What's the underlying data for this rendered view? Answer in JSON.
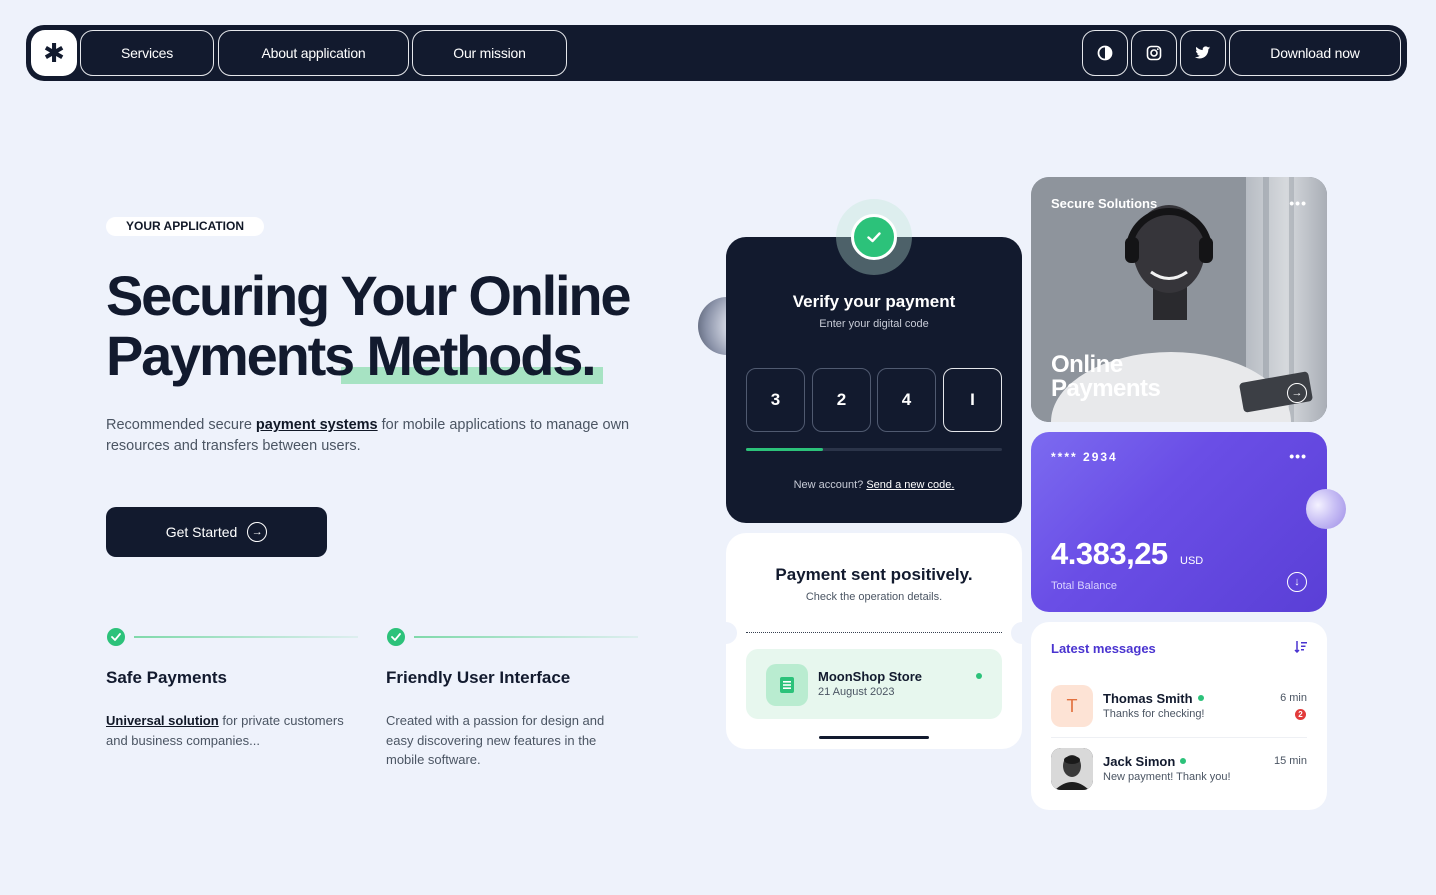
{
  "nav": {
    "logo": "✱",
    "links": [
      "Services",
      "About application",
      "Our mission"
    ],
    "icons": [
      "theme-toggle-icon",
      "instagram-icon",
      "twitter-icon"
    ],
    "download_label": "Download now"
  },
  "hero": {
    "badge": "YOUR APPLICATION",
    "title_line1": "Securing Your Online",
    "title_line2": "Payments Methods.",
    "desc_before": "Recommended secure ",
    "desc_link": "payment systems",
    "desc_after": " for mobile applications to manage own resources and transfers between users.",
    "cta_label": "Get Started"
  },
  "features": [
    {
      "title": "Safe Payments",
      "desc_link": "Universal solution",
      "desc": " for private customers and business companies..."
    },
    {
      "title": "Friendly User Interface",
      "desc_link": "",
      "desc": "Created with a passion for design and easy discovering new features in the mobile software."
    }
  ],
  "verify": {
    "title": "Verify your payment",
    "subtitle": "Enter your digital code",
    "code": [
      "3",
      "2",
      "4",
      "I"
    ],
    "progress": 0.3,
    "footer_text": "New account? ",
    "footer_link": "Send a new code."
  },
  "receipt": {
    "title": "Payment sent positively.",
    "subtitle": "Check the operation details.",
    "store_name": "MoonShop Store",
    "store_date": "21 August 2023"
  },
  "photo_card": {
    "label": "Secure Solutions",
    "menu": "•••",
    "title_line1": "Online",
    "title_line2": "Payments"
  },
  "balance": {
    "card_number": "**** 2934",
    "menu": "•••",
    "amount": "4.383,25",
    "currency": "USD",
    "label": "Total Balance"
  },
  "messages": {
    "title": "Latest messages",
    "items": [
      {
        "initial": "T",
        "name": "Thomas Smith",
        "text": "Thanks for checking!",
        "time": "6 min",
        "unread": "2"
      },
      {
        "initial": "",
        "name": "Jack Simon",
        "text": "New payment! Thank you!",
        "time": "15 min",
        "unread": ""
      }
    ]
  },
  "colors": {
    "navy": "#121a2e",
    "green": "#2cc27a",
    "purple": "#6a4ee6",
    "background": "#eef2fb"
  }
}
